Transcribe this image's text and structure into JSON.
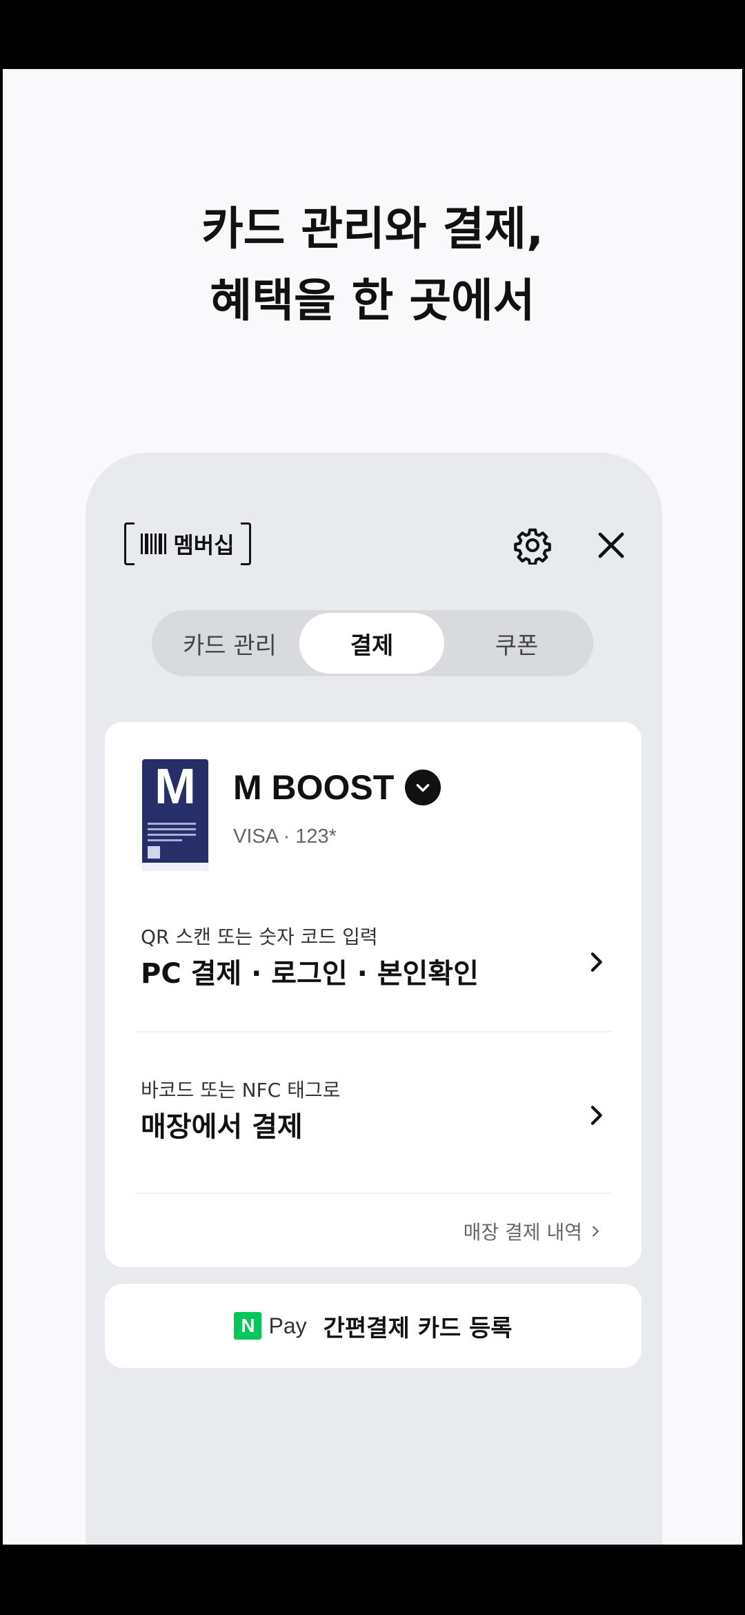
{
  "headline": {
    "line1": "카드 관리와 결제,",
    "line2": "혜택을 한 곳에서"
  },
  "header": {
    "membership_label": "멤버십"
  },
  "tabs": [
    {
      "label": "카드 관리",
      "selected": false
    },
    {
      "label": "결제",
      "selected": true
    },
    {
      "label": "쿠폰",
      "selected": false
    }
  ],
  "card": {
    "name": "M BOOST",
    "thumb_letter": "M",
    "sub": "VISA · 123*"
  },
  "options": [
    {
      "sub": "QR 스캔 또는 숫자 코드 입력",
      "title": "PC 결제 · 로그인 · 본인확인"
    },
    {
      "sub": "바코드 또는 NFC 태그로",
      "title": "매장에서 결제"
    }
  ],
  "history_link": "매장 결제 내역",
  "npay": {
    "logo": "N",
    "word": "Pay",
    "label": "간편결제 카드 등록"
  },
  "colors": {
    "npay_green": "#03c75a",
    "card_navy": "#262f6a",
    "panel_gray": "#e9eaed"
  }
}
